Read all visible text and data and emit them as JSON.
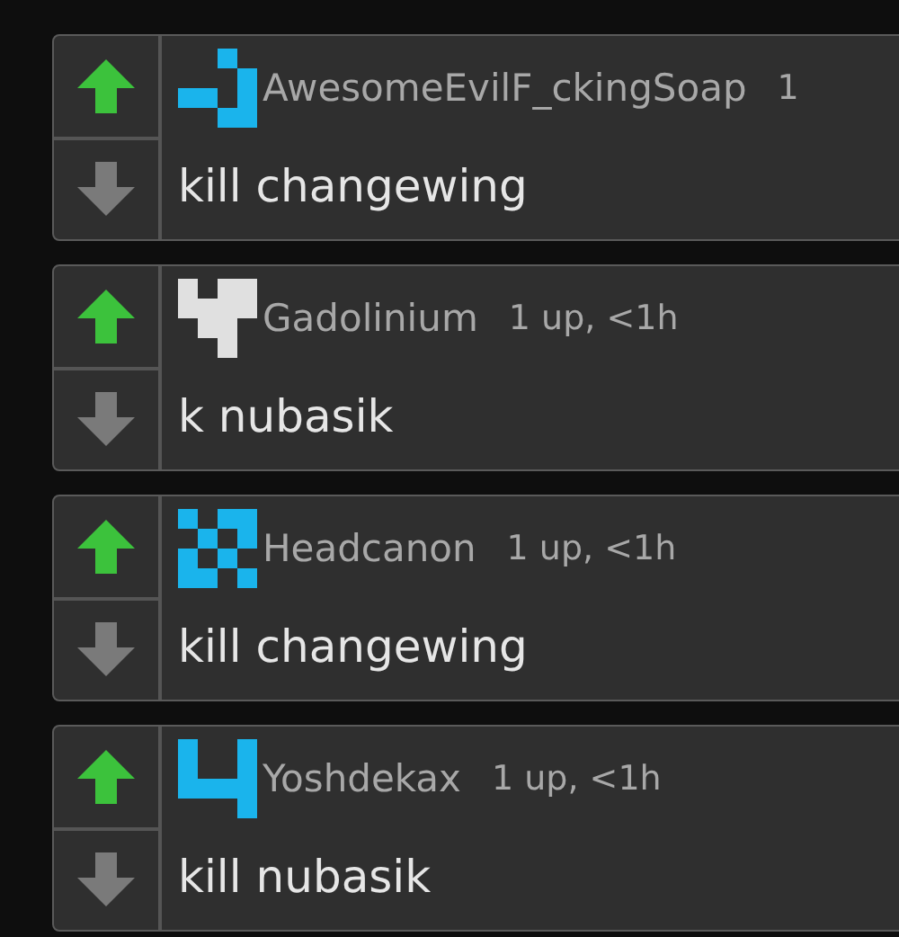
{
  "comments": [
    {
      "username": "AwesomeEvilF_ckingSoap",
      "meta": "1",
      "text": "kill changewing",
      "upvoted": true,
      "downvoted": false,
      "color": "#1ab4ec"
    },
    {
      "username": "Gadolinium",
      "meta": "1 up, <1h",
      "text": "k nubasik",
      "upvoted": true,
      "downvoted": false,
      "color": "#e0e0e0"
    },
    {
      "username": "Headcanon",
      "meta": "1 up, <1h",
      "text": "kill changewing",
      "upvoted": true,
      "downvoted": false,
      "color": "#1ab4ec"
    },
    {
      "username": "Yoshdekax",
      "meta": "1 up, <1h",
      "text": "kill nubasik",
      "upvoted": true,
      "downvoted": false,
      "color": "#1ab4ec"
    }
  ]
}
